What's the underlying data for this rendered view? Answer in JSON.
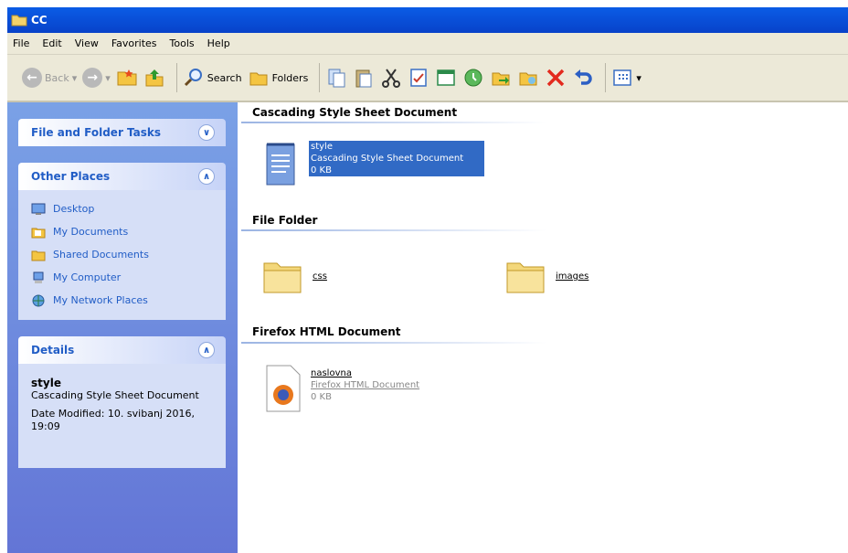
{
  "window": {
    "title": "CC"
  },
  "menu": [
    "File",
    "Edit",
    "View",
    "Favorites",
    "Tools",
    "Help"
  ],
  "toolbar": {
    "back_label": "Back",
    "search_label": "Search",
    "folders_label": "Folders"
  },
  "left": {
    "file_tasks_title": "File and Folder Tasks",
    "other_places_title": "Other Places",
    "places": [
      "Desktop",
      "My Documents",
      "Shared Documents",
      "My Computer",
      "My Network Places"
    ],
    "details_title": "Details",
    "details": {
      "name": "style",
      "type": "Cascading Style Sheet Document",
      "date": "Date Modified: 10. svibanj 2016, 19:09"
    }
  },
  "groups": {
    "css_doc": "Cascading Style Sheet Document",
    "folder": "File Folder",
    "html_doc": "Firefox HTML Document"
  },
  "files": {
    "style": {
      "name": "style",
      "type": "Cascading Style Sheet Document",
      "size": "0 KB"
    },
    "folder1": {
      "name": "css"
    },
    "folder2": {
      "name": "images"
    },
    "naslovna": {
      "name": "naslovna",
      "type": "Firefox HTML Document",
      "size": "0 KB"
    }
  },
  "colors": {
    "titlebar": "#0a5ce6",
    "panel_title": "#215dc6",
    "selection": "#316ac5"
  }
}
